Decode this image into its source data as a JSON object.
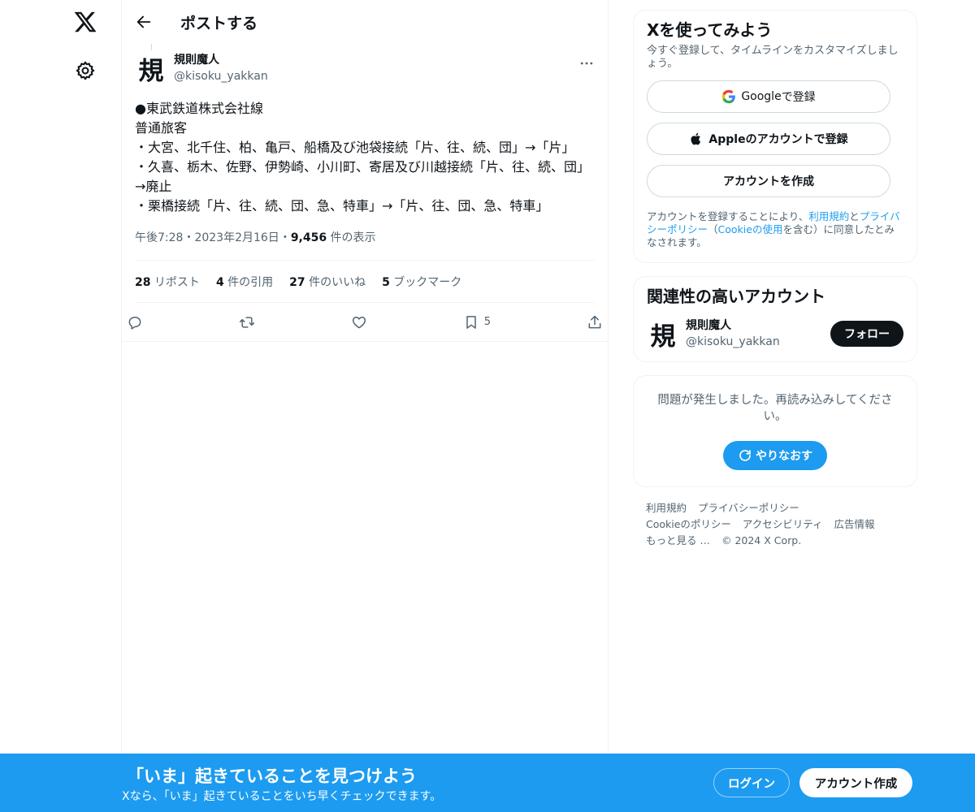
{
  "header": {
    "title": "ポストする"
  },
  "post": {
    "avatar_char": "規",
    "author_name": "規則魔人",
    "author_handle": "@kisoku_yakkan",
    "body": [
      "●東武鉄道株式会社線",
      "普通旅客",
      "・大宮、北千住、柏、亀戸、船橋及び池袋接続「片、往、続、団」→「片」",
      "・久喜、栃木、佐野、伊勢崎、小川町、寄居及び川越接続「片、往、続、団」→廃止",
      "・栗橋接続「片、往、続、団、急、特車」→「片、往、団、急、特車」"
    ],
    "time": "午後7:28",
    "sep": "・",
    "date": "2023年2月16日",
    "views_count": "9,456",
    "views_label": " 件の表示",
    "stats": [
      {
        "count": "28",
        "label": " リポスト"
      },
      {
        "count": "4",
        "label": " 件の引用"
      },
      {
        "count": "27",
        "label": " 件のいいね"
      },
      {
        "count": "5",
        "label": " ブックマーク"
      }
    ],
    "bookmark_count": "5"
  },
  "signup": {
    "title": "Xを使ってみよう",
    "subtitle": "今すぐ登録して、タイムラインをカスタマイズしましょう。",
    "google_strong": "Google",
    "google_rest": " で登録",
    "apple_label": "Appleのアカウントで登録",
    "create_label": "アカウントを作成",
    "legal_1": "アカウントを登録することにより、",
    "legal_terms": "利用規約",
    "legal_2": "と",
    "legal_privacy": "プライバシーポリシー",
    "legal_3": "（",
    "legal_cookie": "Cookieの使用",
    "legal_4": "を含む）に同意したとみなされます。"
  },
  "related": {
    "title": "関連性の高いアカウント",
    "avatar_char": "規",
    "name": "規則魔人",
    "handle": "@kisoku_yakkan",
    "follow_label": "フォロー"
  },
  "error": {
    "message": "問題が発生しました。再読み込みしてください。",
    "retry_label": "やりなおす"
  },
  "footer": {
    "links": [
      "利用規約",
      "プライバシーポリシー",
      "Cookieのポリシー",
      "アクセシビリティ",
      "広告情報",
      "もっと見る …"
    ],
    "copyright": "© 2024 X Corp."
  },
  "bottombar": {
    "title": "「いま」起きていることを見つけよう",
    "subtitle": "Xなら、「いま」起きていることをいち早くチェックできます。",
    "login_label": "ログイン",
    "signup_label": "アカウント作成"
  },
  "colors": {
    "accent": "#1d9bf0",
    "text": "#0f1419",
    "muted": "#536471",
    "border": "#eff3f4"
  }
}
